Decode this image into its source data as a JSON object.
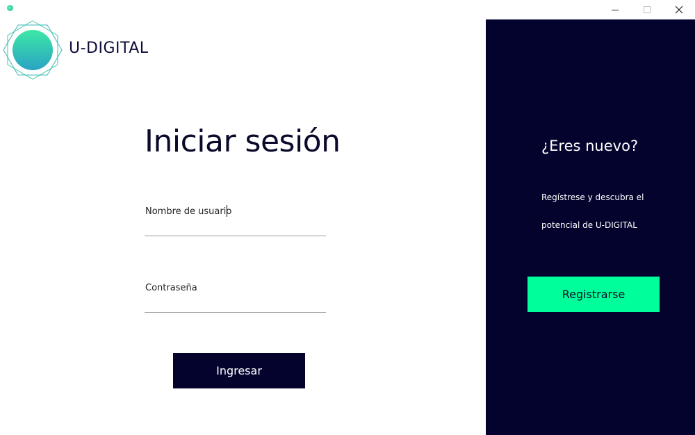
{
  "window": {
    "minimize_icon": "minimize-icon",
    "maximize_icon": "maximize-icon",
    "close_icon": "close-icon"
  },
  "brand": {
    "name": "U-DIGITAL",
    "logo_icon": "hexagon-circle-logo",
    "logo_colors": [
      "#3de8a6",
      "#2aa3c4"
    ]
  },
  "login": {
    "title": "Iniciar sesión",
    "username_placeholder": "Nombre de usuario",
    "password_placeholder": "Contraseña",
    "submit_label": "Ingresar"
  },
  "signup": {
    "title": "¿Eres nuevo?",
    "description_line1": "Regístrese y descubra el",
    "description_line2": "potencial de U-DIGITAL",
    "button_label": "Registrarse"
  },
  "colors": {
    "navy": "#03032e",
    "accent_green": "#00ff9a"
  }
}
